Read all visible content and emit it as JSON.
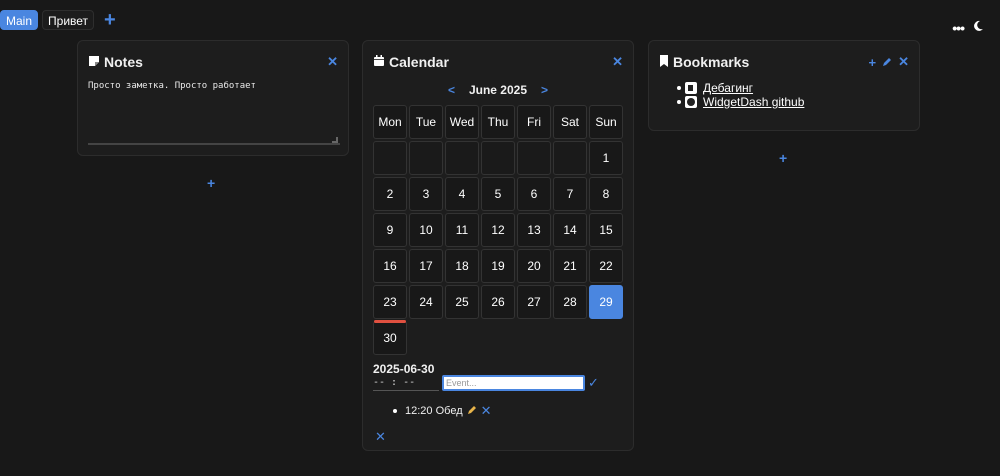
{
  "tabs": [
    {
      "label": "Main",
      "active": true
    },
    {
      "label": "Привет",
      "active": false
    }
  ],
  "tab_add_label": "+",
  "toolbar": {
    "menu_icon": "dots-icon",
    "theme_icon": "moon-icon"
  },
  "notes": {
    "title": "Notes",
    "text": "Просто заметка. Просто работает",
    "add_label": "+"
  },
  "calendar": {
    "title": "Calendar",
    "month_label": "June 2025",
    "weekdays": [
      "Mon",
      "Tue",
      "Wed",
      "Thu",
      "Fri",
      "Sat",
      "Sun"
    ],
    "leading_blanks": 6,
    "days": [
      "1",
      "2",
      "3",
      "4",
      "5",
      "6",
      "7",
      "8",
      "9",
      "10",
      "11",
      "12",
      "13",
      "14",
      "15",
      "16",
      "17",
      "18",
      "19",
      "20",
      "21",
      "22",
      "23",
      "24",
      "25",
      "26",
      "27",
      "28",
      "29",
      "30"
    ],
    "selected_day": "29",
    "today_day": "23",
    "event_date": "2025-06-30",
    "time_placeholder": "-- : --",
    "event_placeholder": "Event...",
    "events": [
      {
        "text": "12:20 Обед"
      }
    ]
  },
  "bookmarks": {
    "title": "Bookmarks",
    "items": [
      {
        "label": "Дебагинг",
        "icon": "page-favicon-icon"
      },
      {
        "label": "WidgetDash github",
        "icon": "github-icon"
      }
    ],
    "add_label": "+"
  },
  "colors": {
    "accent": "#4a86e0",
    "background": "#181818",
    "panel": "#1d1d1d",
    "today": "#e05040"
  }
}
